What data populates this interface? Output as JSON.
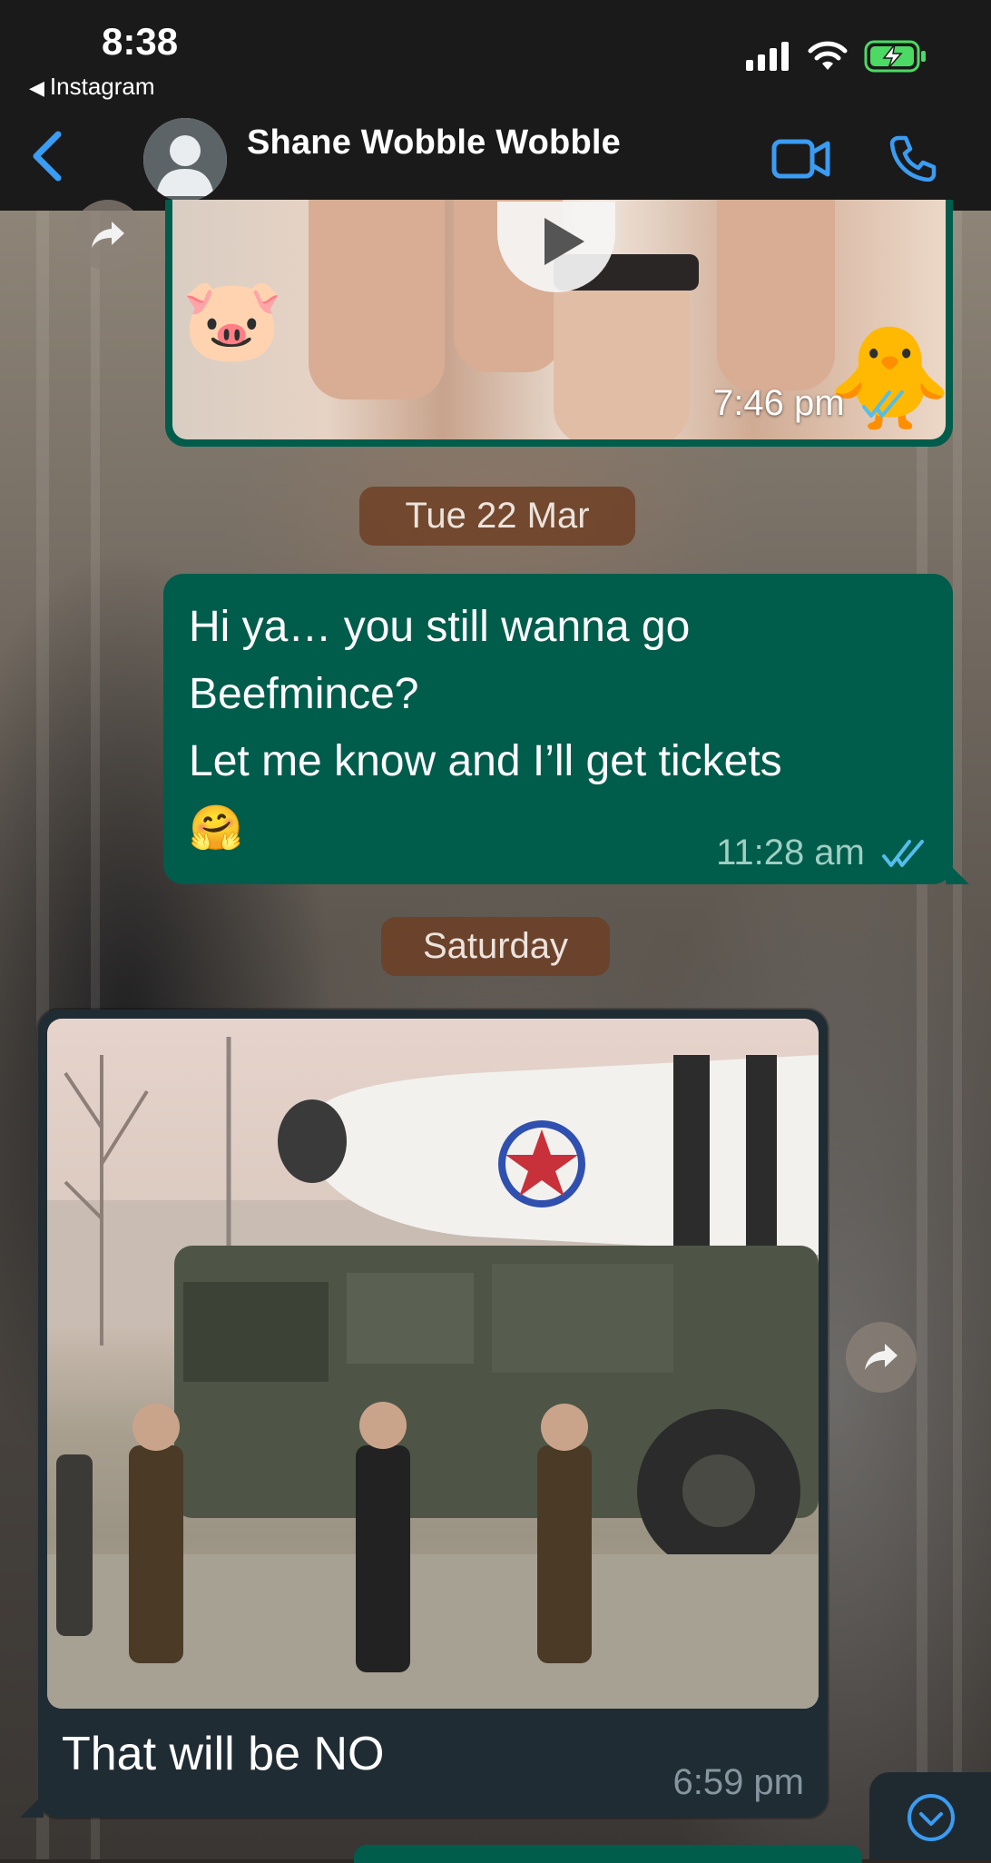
{
  "status_bar": {
    "time": "8:38",
    "back_app": "Instagram"
  },
  "header": {
    "contact_name": "Shane Wobble Wobble"
  },
  "messages": {
    "video_out": {
      "time": "7:46 pm"
    },
    "date_1": "Tue 22 Mar",
    "text_out": {
      "line1": "Hi ya… you still wanna go",
      "line2": "Beefmince?",
      "line3": "Let me know and I’ll get tickets",
      "emoji": "🤗",
      "time": "11:28 am"
    },
    "date_2": "Saturday",
    "image_in": {
      "caption": "That will be NO",
      "time": "6:59 pm"
    }
  },
  "emoji": {
    "pig": "🐷",
    "chick": "🐥"
  },
  "colors": {
    "outgoing_bubble": "#005c4b",
    "incoming_bubble": "#202c33",
    "accent_blue": "#3a9cf2",
    "read_ticks": "#53bdeb"
  },
  "icons": [
    "back-arrow-icon",
    "avatar-icon",
    "video-call-icon",
    "phone-icon",
    "forward-icon",
    "play-icon",
    "scroll-down-icon",
    "signal-icon",
    "wifi-icon",
    "battery-charging-icon"
  ]
}
